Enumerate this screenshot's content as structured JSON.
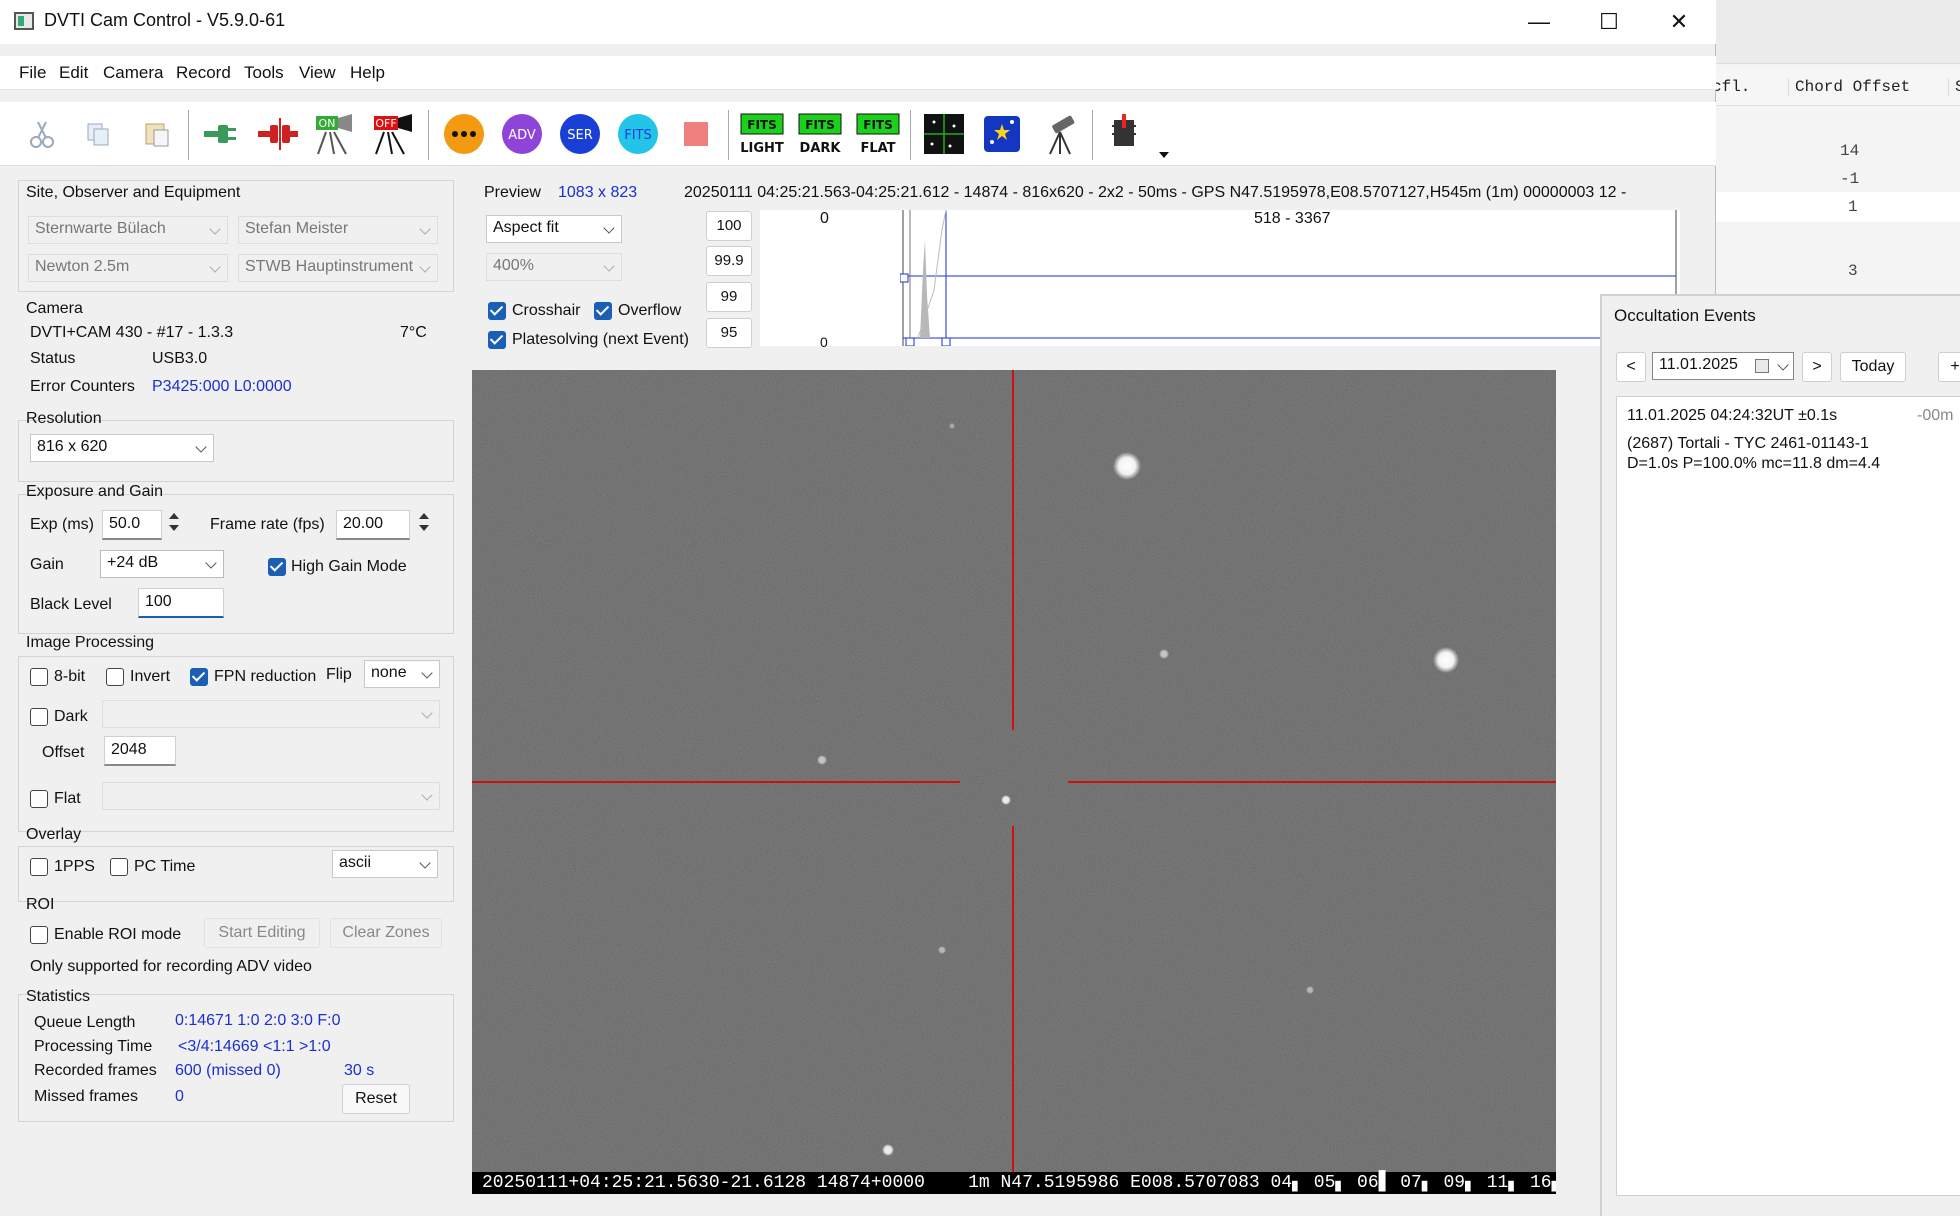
{
  "window": {
    "title": "DVTI Cam Control - V5.9.0-61",
    "minimize": "—",
    "maximize": "☐",
    "close": "✕"
  },
  "menu": [
    "File",
    "Edit",
    "Camera",
    "Record",
    "Tools",
    "View",
    "Help"
  ],
  "toolbar": {
    "on_label": "ON",
    "off_label": "OFF",
    "adv_label": "ADV",
    "ser_label": "SER",
    "fits_label": "FITS",
    "fits_light": "LIGHT",
    "fits_dark": "DARK",
    "fits_flat": "FLAT"
  },
  "site": {
    "title": "Site, Observer and Equipment",
    "site": "Sternwarte Bülach",
    "observer": "Stefan Meister",
    "telescope": "Newton 2.5m",
    "instrument": "STWB Hauptinstrument"
  },
  "camera": {
    "title": "Camera",
    "model": "DVTI+CAM 430  -  #17  -  1.3.3",
    "temperature": "7°C",
    "status_label": "Status",
    "status_value": "USB3.0",
    "errors_label": "Error Counters",
    "errors_value": "P3425:000 L0:0000"
  },
  "resolution": {
    "title": "Resolution",
    "value": "816 x 620"
  },
  "exposure": {
    "title": "Exposure and Gain",
    "exp_label": "Exp (ms)",
    "exp_value": "50.0",
    "fps_label": "Frame rate (fps)",
    "fps_value": "20.00",
    "gain_label": "Gain",
    "gain_value": "+24 dB",
    "high_gain_label": "High Gain Mode",
    "black_label": "Black Level",
    "black_value": "100"
  },
  "processing": {
    "title": "Image Processing",
    "bit8": "8-bit",
    "invert": "Invert",
    "fpn": "FPN reduction",
    "flip_label": "Flip",
    "flip_value": "none",
    "dark": "Dark",
    "offset_label": "Offset",
    "offset_value": "2048",
    "flat": "Flat"
  },
  "overlay": {
    "title": "Overlay",
    "pps": "1PPS",
    "pctime": "PC Time",
    "mode": "ascii"
  },
  "roi": {
    "title": "ROI",
    "enable": "Enable ROI mode",
    "start": "Start Editing",
    "clear": "Clear Zones",
    "note": "Only supported for recording ADV video"
  },
  "stats": {
    "title": "Statistics",
    "queue_label": "Queue Length",
    "queue_value": "0:14671  1:0  2:0  3:0  F:0",
    "proc_label": "Processing Time",
    "proc_value": "<3/4:14669 <1:1  >1:0",
    "rec_label": "Recorded frames",
    "rec_value": "600 (missed 0)",
    "rec_time": "30 s",
    "missed_label": "Missed frames",
    "missed_value": "0",
    "reset": "Reset"
  },
  "preview": {
    "label": "Preview",
    "size": "1083 x 823",
    "info": "20250111 04:25:21.563-04:25:21.612 - 14874 - 816x620 - 2x2 - 50ms - GPS N47.5195978,E08.5707127,H545m (1m) 00000003 12 -",
    "range": "518 - 3367",
    "fit": "Aspect fit",
    "zoom": "400%",
    "crosshair": "Crosshair",
    "overflow": "Overflow",
    "platesolve": "Platesolving (next Event)",
    "pct": [
      "100",
      "99.9",
      "99",
      "95"
    ],
    "hist_top": "0",
    "hist_bottom": "0",
    "overlay_text": "20250111+04:25:21.5630-21.6128 14874+0000    1m N47.5195986 E008.5707083 04▖ 05▖ 06▋ 07▖ 09▖ 11▖ 16▖"
  },
  "occultation": {
    "title": "Occultation Events",
    "prev": "<",
    "next": ">",
    "date": "11.01.2025",
    "today": "Today",
    "plus": "+",
    "event_time": "11.01.2025 04:24:32UT ±0.1s",
    "event_ago": "-00m",
    "event_name": "(2687) Tortali - TYC 2461-01143-1",
    "event_stats": "D=1.0s   P=100.0%   mc=11.8   dm=4.4"
  },
  "bgtable": {
    "col1": "cfl.",
    "col2": "Chord Offset",
    "col3": "S",
    "values": [
      "14",
      "-1",
      "1",
      "3"
    ]
  }
}
